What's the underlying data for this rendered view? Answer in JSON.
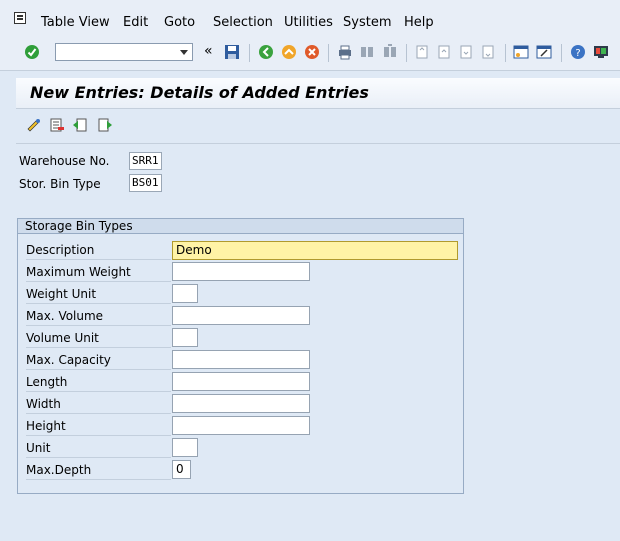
{
  "menu": {
    "items": [
      "Table View",
      "Edit",
      "Goto",
      "Selection",
      "Utilities",
      "System",
      "Help"
    ]
  },
  "toolbar": {
    "command_field_value": "",
    "icons": [
      "enter-icon",
      "command-field",
      "back-arrows-icon",
      "save-icon",
      "back-icon",
      "exit-icon",
      "cancel-icon",
      "print-icon",
      "find-icon",
      "find-next-icon",
      "first-page-icon",
      "previous-page-icon",
      "next-page-icon",
      "last-page-icon",
      "create-session-icon",
      "shortcut-icon",
      "help-icon",
      "customize-layout-icon"
    ]
  },
  "page_title": "New Entries: Details of Added Entries",
  "app_toolbar": {
    "icons": [
      "change-display-icon",
      "delete-icon",
      "previous-entry-icon",
      "next-entry-icon"
    ]
  },
  "header_fields": {
    "warehouse_label": "Warehouse No.",
    "warehouse_value": "SRR1",
    "bin_type_label": "Stor. Bin Type",
    "bin_type_value": "BS01"
  },
  "group": {
    "title": "Storage Bin Types",
    "rows": [
      {
        "label": "Description",
        "value": "Demo"
      },
      {
        "label": "Maximum Weight",
        "value": ""
      },
      {
        "label": "Weight Unit",
        "value": ""
      },
      {
        "label": "Max. Volume",
        "value": ""
      },
      {
        "label": "Volume Unit",
        "value": ""
      },
      {
        "label": "Max. Capacity",
        "value": ""
      },
      {
        "label": "Length",
        "value": ""
      },
      {
        "label": "Width",
        "value": ""
      },
      {
        "label": "Height",
        "value": ""
      },
      {
        "label": "Unit",
        "value": ""
      },
      {
        "label": "Max.Depth",
        "value": "0"
      }
    ]
  },
  "colors": {
    "background": "#dfe9f5",
    "group_header": "#cfdcec",
    "active_field": "#fff3a6"
  }
}
